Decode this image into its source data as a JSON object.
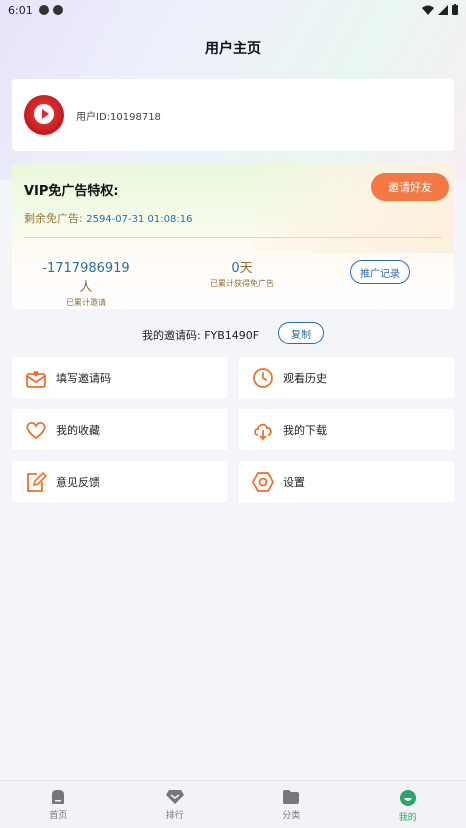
{
  "status_bar": {
    "time": "6:01"
  },
  "header": {
    "title": "用户主页"
  },
  "user": {
    "id_label": "用户ID:10198718"
  },
  "vip": {
    "title": "VIP免广告特权:",
    "invite_button": "邀请好友",
    "remain_label": "剩余免广告:",
    "remain_value": "2594-07-31 01:08:16",
    "invited_count": "-1717986919",
    "invited_unit": "人",
    "invited_caption": "已累计邀请",
    "days_count": "0",
    "days_unit": "天",
    "days_caption": "已累计获得免广告",
    "promo_button": "推广记录"
  },
  "invite_code": {
    "label": "我的邀请码:",
    "code": "FYB1490F",
    "copy_button": "复制"
  },
  "menu": [
    {
      "label": "填写邀请码",
      "icon": "envelope-heart-icon"
    },
    {
      "label": "观看历史",
      "icon": "clock-icon"
    },
    {
      "label": "我的收藏",
      "icon": "heart-icon"
    },
    {
      "label": "我的下载",
      "icon": "cloud-download-icon"
    },
    {
      "label": "意见反馈",
      "icon": "edit-note-icon"
    },
    {
      "label": "设置",
      "icon": "hexagon-settings-icon"
    }
  ],
  "nav": [
    {
      "label": "首页",
      "icon": "home-icon"
    },
    {
      "label": "排行",
      "icon": "diamond-icon"
    },
    {
      "label": "分类",
      "icon": "folder-icon"
    },
    {
      "label": "我的",
      "icon": "profile-icon",
      "active": true
    }
  ],
  "colors": {
    "accent_orange": "#f37a45",
    "accent_blue": "#2e6aa5",
    "nav_active": "#2aa56b"
  }
}
